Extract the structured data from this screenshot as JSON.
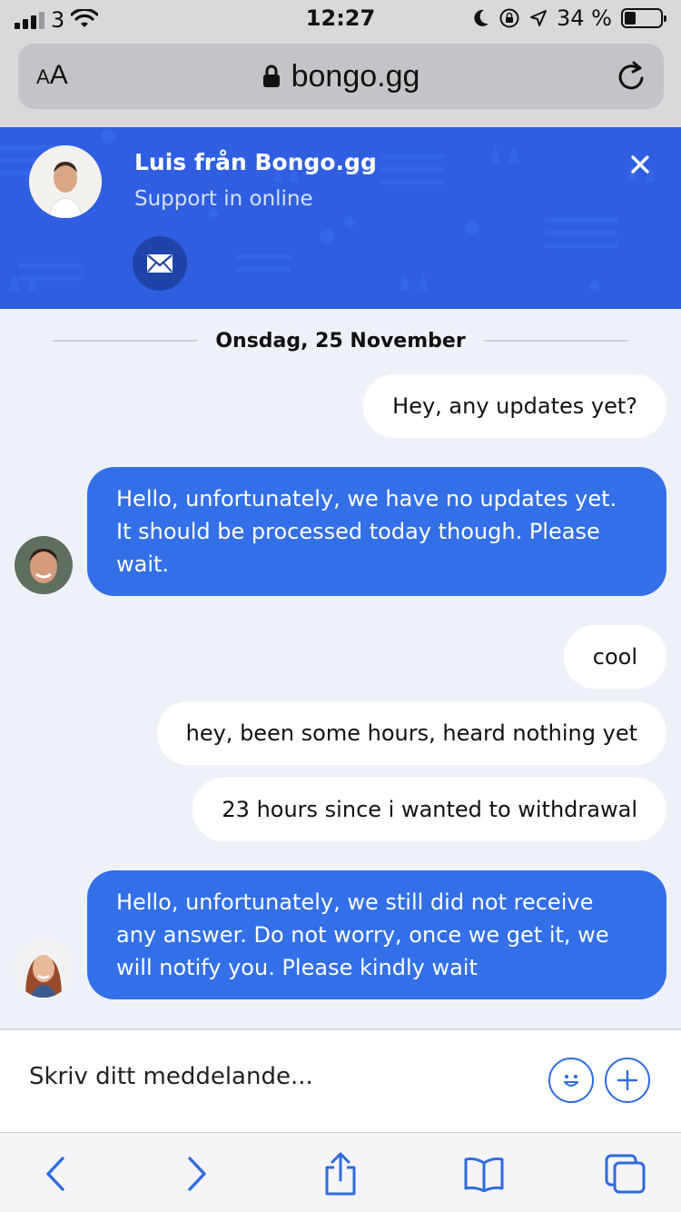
{
  "status_bar": {
    "carrier": "3",
    "time": "12:27",
    "battery": "34 %"
  },
  "browser": {
    "aa_small": "A",
    "aa_large": "A",
    "url": "bongo.gg"
  },
  "chat_header": {
    "agent_name": "Luis från Bongo.gg",
    "agent_status": "Support in online",
    "accent_color": "#2f5fe0"
  },
  "messages": {
    "date_divider": "Onsdag, 25 November",
    "items": [
      {
        "from": "user",
        "text": "Hey, any updates yet?"
      },
      {
        "from": "agent",
        "text": "Hello, unfortunately, we have no updates yet. It should be processed today though. Please wait."
      },
      {
        "from": "user",
        "text": "cool"
      },
      {
        "from": "user",
        "text": "hey, been some hours, heard nothing yet"
      },
      {
        "from": "user",
        "text": "23 hours since i wanted to withdrawal"
      },
      {
        "from": "agent",
        "text": "Hello, unfortunately, we still did not receive any answer. Do not worry, once we get it, we will notify you. Please kindly wait"
      }
    ]
  },
  "composer": {
    "placeholder": "Skriv ditt meddelande..."
  },
  "icons": {
    "mail": "envelope-icon",
    "close": "close-icon",
    "emoji": "smiley-icon",
    "attach": "plus-icon",
    "back": "chevron-left-icon",
    "forward": "chevron-right-icon",
    "share": "share-icon",
    "bookmarks": "book-icon",
    "tabs": "tabs-icon"
  }
}
